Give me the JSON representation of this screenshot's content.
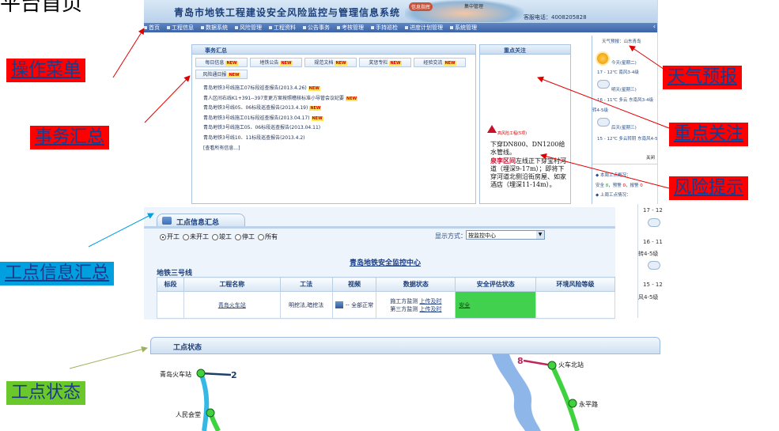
{
  "slide": {
    "title": "平台首页"
  },
  "top_screenshot": {
    "banner_title": "青岛市地铁工程建设安全风险监控与管理信息系统",
    "banner_badge_1": "信息指挥",
    "banner_badge_2": "集中管理",
    "phone": "客服电话：4008205828",
    "nav": [
      "首页",
      "工程信息",
      "数据系统",
      "风险管理",
      "工程资料",
      "公告事务",
      "考核管理",
      "手持巡检",
      "进度计划管理",
      "系统管理"
    ],
    "affairs": {
      "title": "事务汇总",
      "tabs": [
        {
          "label": "每日信息",
          "badge": "NEW"
        },
        {
          "label": "地铁公告",
          "badge": "NEW"
        },
        {
          "label": "规范文档",
          "badge": "NEW"
        },
        {
          "label": "奖惩专栏",
          "badge": "NEW"
        },
        {
          "label": "经验交流",
          "badge": "NEW"
        },
        {
          "label": "风险通日报",
          "badge": "NEW"
        }
      ],
      "news": [
        {
          "text": "青岛地铁3号线施工07标段巡查报告(2013.4.26)",
          "badge": "NEW"
        },
        {
          "text": "青人区间右线K1+391--397变更方案按照稽核标准小导管会议纪要",
          "badge": "NEW"
        },
        {
          "text": "青岛地铁3号线05、06标段巡查报告(2013.4.19)",
          "badge": "NEW"
        },
        {
          "text": "青岛地铁3号线施工01标段巡查报告(2013.04.17)",
          "badge": "NEW"
        },
        {
          "text": "青岛地铁3号线施工05、06标段巡查报告(2013.04.11)",
          "badge": ""
        },
        {
          "text": "青岛地铁3号线10、11标段巡查报告(2013.4.2)",
          "badge": ""
        }
      ],
      "more": "[查看所有信息...]"
    },
    "focus": {
      "title": "重点关注",
      "warning_label": "高风险工程(5项)",
      "text_1": "下穿DN800、DN1200给水管线。",
      "text_highlight": "泉李区间",
      "text_2": "左线正下穿宝村河道（埋深9-17m）；即将下穿河道北侧沿街房屋、如家酒店（埋深11-14m）。"
    },
    "weather": {
      "title": "天气预报：山东青岛",
      "day1": "今天(星期二)",
      "day1_detail": "17 - 12℃ 南风3-4级",
      "day2": "明天(星期三)",
      "day2_detail": "16 - 11℃ 多云 东南风3-4级",
      "day2_extra": "转4-5级",
      "day3": "后天(星期三)",
      "day3_detail": "15 - 12℃ 多云转阴 东南风4-5级",
      "close": "关闭",
      "stat_1": "本周工点概况：",
      "stat_2_prefix": "安全 ",
      "stat_2_a": "8",
      "stat_2_mid": "，预警 ",
      "stat_2_b": "0",
      "stat_2_mid2": "，报警 ",
      "stat_2_c": "0",
      "stat_3": "上周工点情况："
    }
  },
  "middle_screenshot": {
    "tab_title": "工点信息汇总",
    "radios": [
      {
        "label": "开工",
        "checked": true
      },
      {
        "label": "未开工",
        "checked": false
      },
      {
        "label": "竣工",
        "checked": false
      },
      {
        "label": "停工",
        "checked": false
      },
      {
        "label": "所有",
        "checked": false
      }
    ],
    "display_label": "显示方式：",
    "display_value": "按监控中心",
    "center_link": "青岛地铁安全监控中心",
    "line_label": "地铁三号线",
    "headers": [
      "标段",
      "工程名称",
      "工法",
      "视频",
      "数据状态",
      "安全评估状态",
      "环境风险等级"
    ],
    "row": {
      "section": "",
      "name": "青岛火车站",
      "method": "明挖法,暗挖法",
      "video": "-- 全部正常",
      "status_1_label": "施工方监测",
      "status_1_link": "上传及时",
      "status_2_label": "第三方监测",
      "status_2_link": "上传及时",
      "safety": "安全",
      "env": ""
    },
    "right_strip": [
      "17 - 12",
      "16 - 11",
      "转4-5级",
      "15 - 12",
      "风4-5级"
    ]
  },
  "bottom_screenshot": {
    "title": "工点状态",
    "stations": [
      "青岛火车站",
      "人民会堂",
      "火车北站",
      "永平路"
    ],
    "line_numbers": [
      "2",
      "8"
    ]
  },
  "annotations": {
    "menu": "操作菜单",
    "affairs": "事务汇总",
    "site_info": "工点信息汇总",
    "site_status": "工点状态",
    "weather": "天气预报",
    "focus": "重点关注",
    "risk": "风险提示"
  },
  "colors": {
    "red_label": "#ff0000",
    "blue_label": "#00a0e0",
    "green_label": "#6ac82a",
    "nav_bg": "#3c64a7",
    "safe_green": "#42d04f"
  }
}
